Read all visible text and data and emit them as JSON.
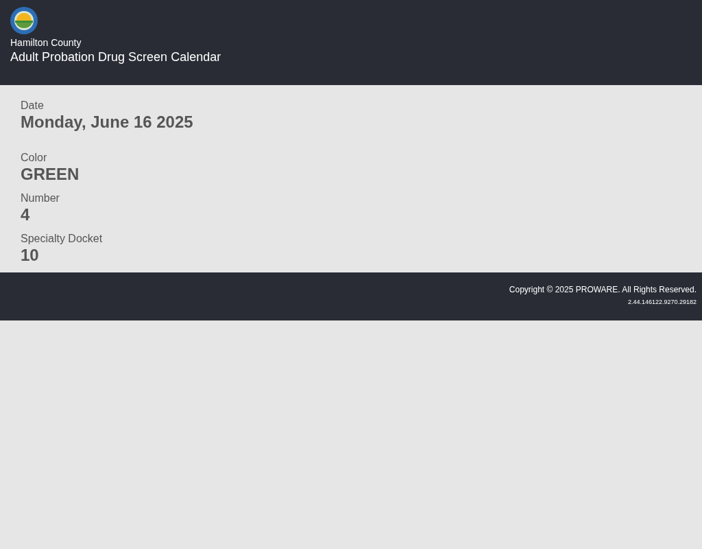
{
  "header": {
    "county": "Hamilton County",
    "title": "Adult Probation Drug Screen Calendar"
  },
  "fields": [
    {
      "label": "Date",
      "value": "Monday, June 16 2025"
    },
    {
      "label": "Color",
      "value": "GREEN"
    },
    {
      "label": "Number",
      "value": "4"
    },
    {
      "label": "Specialty Docket",
      "value": "10"
    }
  ],
  "footer": {
    "copyright": "Copyright © 2025 PROWARE. All Rights Reserved.",
    "version": "2.44.146122.9270.29182"
  }
}
